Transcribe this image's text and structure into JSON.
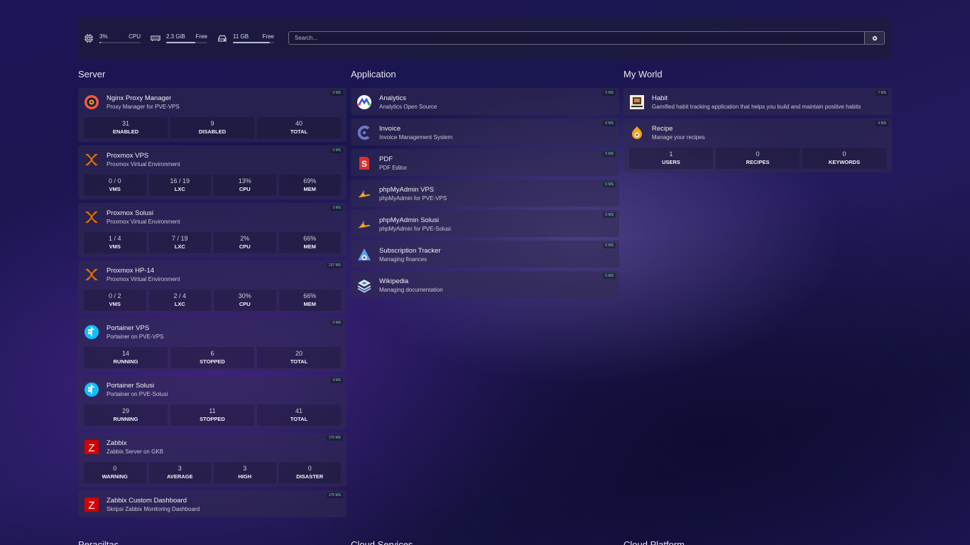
{
  "resources": {
    "cpu": {
      "value": "3%",
      "label": "CPU",
      "fraction": 0.03
    },
    "memory": {
      "value": "2.3 GiB",
      "label": "Free",
      "fraction": 0.7
    },
    "disk": {
      "value": "11 GB",
      "label": "Free",
      "fraction": 0.9
    }
  },
  "search": {
    "placeholder": "Search..."
  },
  "groups": [
    {
      "title": "Server",
      "services": [
        {
          "name": "Nginx Proxy Manager",
          "desc": "Proxy Manager for PVE-VPS",
          "ping": "0 MS",
          "icon": "nginx-proxy-manager-icon",
          "stats": [
            {
              "v": "31",
              "l": "ENABLED"
            },
            {
              "v": "9",
              "l": "DISABLED"
            },
            {
              "v": "40",
              "l": "TOTAL"
            }
          ]
        },
        {
          "name": "Proxmox VPS",
          "desc": "Proxmox Virtual Environment",
          "ping": "0 MS",
          "icon": "proxmox-icon",
          "stats": [
            {
              "v": "0 / 0",
              "l": "VMS"
            },
            {
              "v": "16 / 19",
              "l": "LXC"
            },
            {
              "v": "13%",
              "l": "CPU"
            },
            {
              "v": "69%",
              "l": "MEM"
            }
          ]
        },
        {
          "name": "Proxmox Solusi",
          "desc": "Proxmox Virtual Environment",
          "ping": "3 MS",
          "icon": "proxmox-icon",
          "stats": [
            {
              "v": "1 / 4",
              "l": "VMS"
            },
            {
              "v": "7 / 19",
              "l": "LXC"
            },
            {
              "v": "2%",
              "l": "CPU"
            },
            {
              "v": "66%",
              "l": "MEM"
            }
          ]
        },
        {
          "name": "Proxmox HP-14",
          "desc": "Proxmox Virtual Environment",
          "ping": "137 MS",
          "icon": "proxmox-icon",
          "stats": [
            {
              "v": "0 / 2",
              "l": "VMS"
            },
            {
              "v": "2 / 4",
              "l": "LXC"
            },
            {
              "v": "30%",
              "l": "CPU"
            },
            {
              "v": "66%",
              "l": "MEM"
            }
          ]
        },
        {
          "name": "Portainer VPS",
          "desc": "Portainer on PVE-VPS",
          "ping": "0 MS",
          "icon": "portainer-icon",
          "stats": [
            {
              "v": "14",
              "l": "RUNNING"
            },
            {
              "v": "6",
              "l": "STOPPED"
            },
            {
              "v": "20",
              "l": "TOTAL"
            }
          ]
        },
        {
          "name": "Portainer Solusi",
          "desc": "Portainer on PVE-Solusi",
          "ping": "4 MS",
          "icon": "portainer-icon",
          "stats": [
            {
              "v": "29",
              "l": "RUNNING"
            },
            {
              "v": "11",
              "l": "STOPPED"
            },
            {
              "v": "41",
              "l": "TOTAL"
            }
          ]
        },
        {
          "name": "Zabbix",
          "desc": "Zabbix Server on GKB",
          "ping": "170 MS",
          "icon": "zabbix-icon",
          "stats": [
            {
              "v": "0",
              "l": "WARNING"
            },
            {
              "v": "3",
              "l": "AVERAGE"
            },
            {
              "v": "3",
              "l": "HIGH"
            },
            {
              "v": "0",
              "l": "DISASTER"
            }
          ]
        },
        {
          "name": "Zabbix Custom Dashboard",
          "desc": "Skripsi Zabbix Monitoring Dashboard",
          "ping": "170 MS",
          "icon": "zabbix-icon",
          "stats": []
        }
      ]
    },
    {
      "title": "Application",
      "services": [
        {
          "name": "Analytics",
          "desc": "Analytics Open Source",
          "ping": "0 MS",
          "icon": "analytics-icon",
          "stats": []
        },
        {
          "name": "Invoice",
          "desc": "Invoice Management System",
          "ping": "0 MS",
          "icon": "invoice-icon",
          "stats": []
        },
        {
          "name": "PDF",
          "desc": "PDF Editor",
          "ping": "0 MS",
          "icon": "pdf-icon",
          "stats": []
        },
        {
          "name": "phpMyAdmin VPS",
          "desc": "phpMyAdmin for PVE-VPS",
          "ping": "0 MS",
          "icon": "phpmyadmin-icon",
          "stats": []
        },
        {
          "name": "phpMyAdmin Solusi",
          "desc": "phpMyAdmin for PVE-Solusi",
          "ping": "0 MS",
          "icon": "phpmyadmin-icon",
          "stats": []
        },
        {
          "name": "Subscription Tracker",
          "desc": "Managing finances",
          "ping": "0 MS",
          "icon": "subscription-tracker-icon",
          "stats": []
        },
        {
          "name": "Wikipedia",
          "desc": "Managing documentation",
          "ping": "0 MS",
          "icon": "wiki-icon",
          "stats": []
        }
      ]
    },
    {
      "title": "My World",
      "services": [
        {
          "name": "Habit",
          "desc": "Gamified habit tracking application that helps you build and maintain positive habits",
          "ping": "7 MS",
          "icon": "habit-icon",
          "stats": []
        },
        {
          "name": "Recipe",
          "desc": "Manage your recipes",
          "ping": "4 MS",
          "icon": "recipe-icon",
          "stats": [
            {
              "v": "1",
              "l": "USERS"
            },
            {
              "v": "0",
              "l": "RECIPES"
            },
            {
              "v": "0",
              "l": "KEYWORDS"
            }
          ]
        }
      ]
    }
  ],
  "bottom_groups": [
    "Peraciltas",
    "Cloud Services",
    "Cloud Platform"
  ],
  "colors": {
    "ping": "#6ee0a0",
    "card": "#322c50"
  }
}
